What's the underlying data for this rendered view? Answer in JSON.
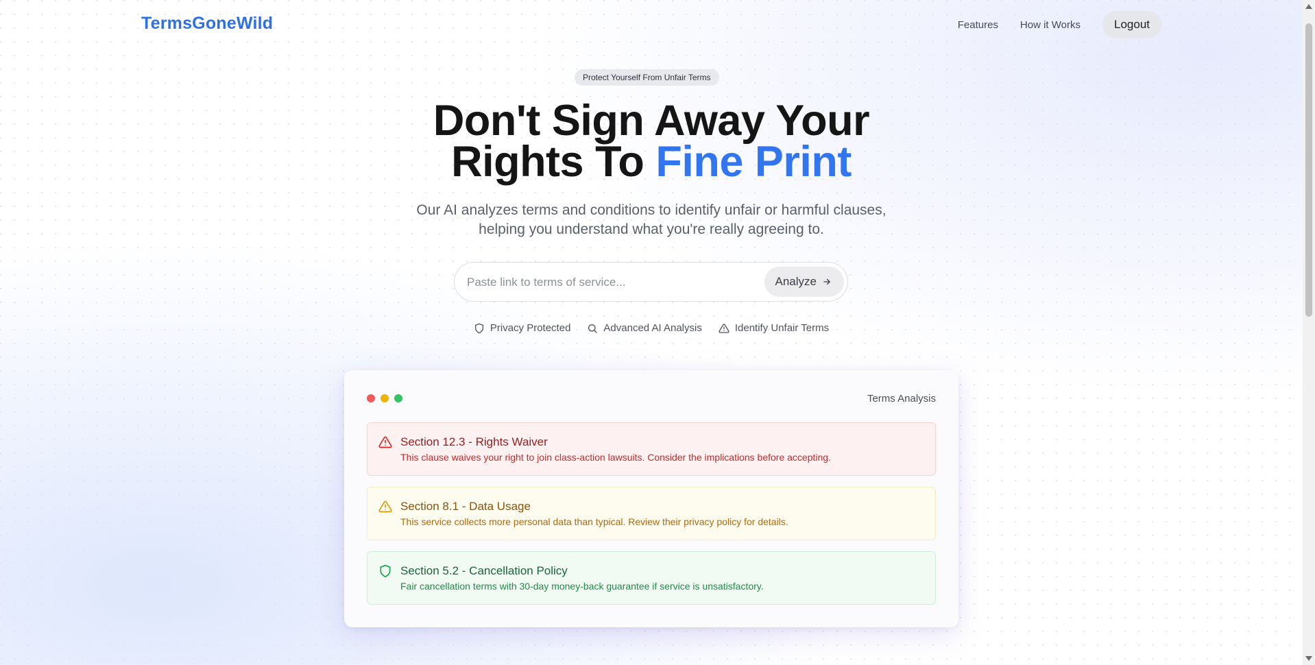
{
  "nav": {
    "logo": "TermsGoneWild",
    "links": [
      "Features",
      "How it Works"
    ],
    "logout_label": "Logout"
  },
  "hero": {
    "badge": "Protect Yourself From Unfair Terms",
    "headline_line1": "Don't Sign Away Your",
    "headline_line2_prefix": "Rights To ",
    "headline_accent": "Fine Print",
    "subhead_line1": "Our AI analyzes terms and conditions to identify unfair or harmful clauses,",
    "subhead_line2": "helping you understand what you're really agreeing to."
  },
  "search": {
    "placeholder": "Paste link to terms of service...",
    "value": "",
    "button_label": "Analyze"
  },
  "features": [
    {
      "label": "Privacy Protected",
      "icon": "shield-icon"
    },
    {
      "label": "Advanced AI Analysis",
      "icon": "search-icon"
    },
    {
      "label": "Identify Unfair Terms",
      "icon": "warning-triangle-icon"
    }
  ],
  "analysis": {
    "title": "Terms Analysis",
    "window_dots": [
      "#ef4444",
      "#eab308",
      "#22c55e"
    ],
    "clauses": [
      {
        "title": "Section 12.3 - Rights Waiver",
        "description": "This clause waives your right to join class-action lawsuits. Consider the implications before accepting.",
        "severity": "red",
        "icon": "warning-triangle-icon"
      },
      {
        "title": "Section 8.1 - Data Usage",
        "description": "This service collects more personal data than typical. Review their privacy policy for details.",
        "severity": "yellow",
        "icon": "warning-triangle-icon"
      },
      {
        "title": "Section 5.2 - Cancellation Policy",
        "description": "Fair cancellation terms with 30-day money-back guarantee if service is unsatisfactory.",
        "severity": "green",
        "icon": "shield-icon"
      }
    ]
  },
  "colors": {
    "brand": "#2f6fe4",
    "accent": "#3276ef"
  }
}
